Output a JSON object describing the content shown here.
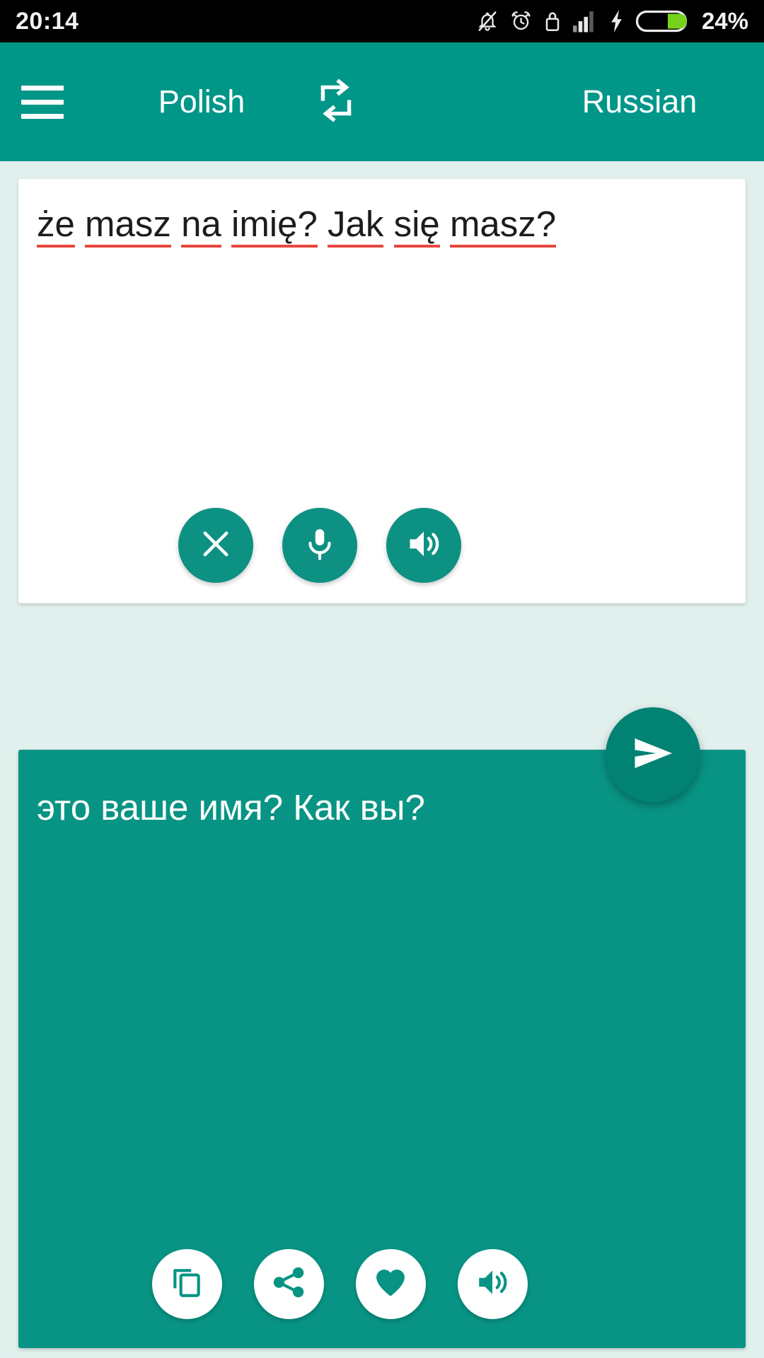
{
  "status_bar": {
    "time": "20:14",
    "battery_percent": "24%",
    "icons": [
      "bell-off-icon",
      "alarm-clock-icon",
      "lock-icon",
      "signal-bars-icon",
      "charging-bolt-icon",
      "battery-icon"
    ]
  },
  "app_bar": {
    "menu_icon": "hamburger-menu-icon",
    "source_language": "Polish",
    "swap_icon": "swap-languages-icon",
    "target_language": "Russian"
  },
  "source_panel": {
    "text": "że masz na imię? Jak się masz?",
    "words": [
      "że",
      "masz",
      "na",
      "imię?",
      "Jak",
      "się",
      "masz?"
    ],
    "spellcheck_underline_color": "#e8473f",
    "actions": [
      {
        "name": "clear-button",
        "icon": "close-x-icon"
      },
      {
        "name": "voice-input-button",
        "icon": "microphone-icon"
      },
      {
        "name": "speak-source-button",
        "icon": "speaker-icon"
      }
    ]
  },
  "send_button": {
    "name": "translate-send-button",
    "icon": "send-paper-plane-icon"
  },
  "target_panel": {
    "text": "это ваше имя? Как вы?",
    "actions": [
      {
        "name": "copy-button",
        "icon": "copy-icon"
      },
      {
        "name": "share-button",
        "icon": "share-icon"
      },
      {
        "name": "favorite-button",
        "icon": "heart-icon"
      },
      {
        "name": "speak-translation-button",
        "icon": "speaker-icon"
      }
    ]
  },
  "colors": {
    "primary_teal": "#009688",
    "card_teal": "#089484",
    "fab_teal": "#028273",
    "button_teal": "#0d9183",
    "page_background": "#E2F0ED",
    "status_bar": "#000000",
    "underline_red": "#e8473f",
    "battery_green": "#76d21d"
  }
}
